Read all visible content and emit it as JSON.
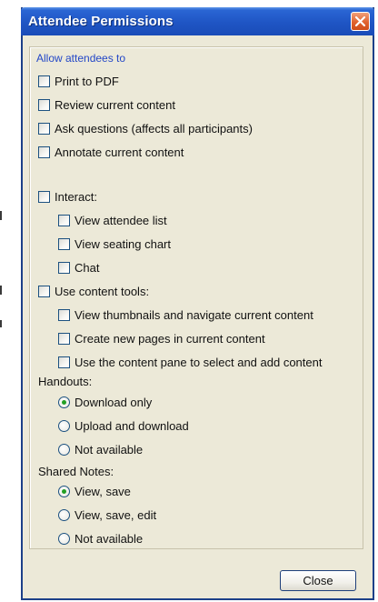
{
  "window": {
    "title": "Attendee Permissions",
    "title_bar_color": "#1f55c4",
    "close_icon": "close-icon"
  },
  "group": {
    "legend": "Allow attendees to"
  },
  "options": {
    "print_to_pdf": {
      "label": "Print to PDF",
      "checked": false
    },
    "review_content": {
      "label": "Review current content",
      "checked": false
    },
    "ask_questions": {
      "label": "Ask questions (affects all participants)",
      "checked": false
    },
    "annotate_content": {
      "label": "Annotate current content",
      "checked": false
    },
    "interact": {
      "label": "Interact:",
      "checked": false
    },
    "view_attendee_list": {
      "label": "View attendee list",
      "checked": false
    },
    "view_seating_chart": {
      "label": "View seating chart",
      "checked": false
    },
    "chat": {
      "label": "Chat",
      "checked": false
    },
    "use_content_tools": {
      "label": "Use content tools:",
      "checked": false
    },
    "view_thumbnails": {
      "label": "View thumbnails and navigate current content",
      "checked": false
    },
    "create_pages": {
      "label": "Create new pages in current content",
      "checked": false
    },
    "use_content_pane": {
      "label": "Use the content pane to select and add content",
      "checked": false
    }
  },
  "handouts": {
    "label": "Handouts:",
    "selected": "Download only",
    "options": [
      "Download only",
      "Upload and download",
      "Not available"
    ]
  },
  "shared_notes": {
    "label": "Shared Notes:",
    "selected": "View, save",
    "options": [
      "View, save",
      "View, save, edit",
      "Not available"
    ]
  },
  "footer": {
    "close_label": "Close"
  }
}
